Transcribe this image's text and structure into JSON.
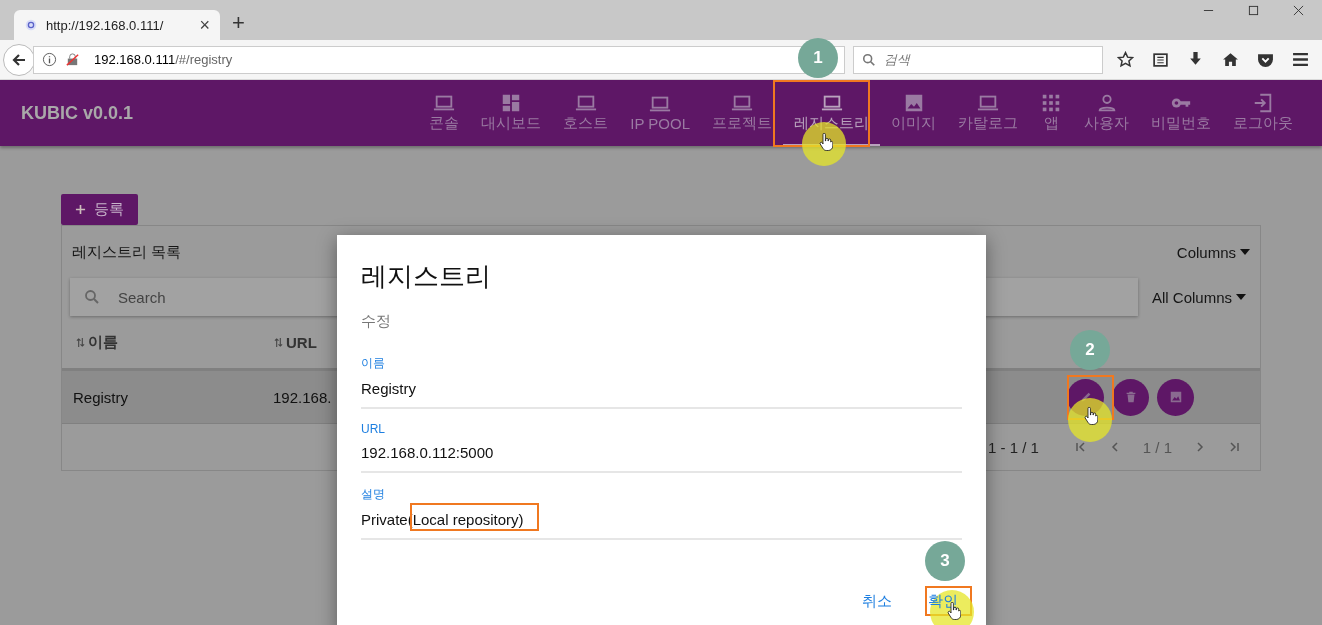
{
  "browser": {
    "tab_title": "http://192.168.0.111/",
    "tab_close": "×",
    "new_tab": "+",
    "address_host": "192.168.0.111",
    "address_path": "/#/registry",
    "search_placeholder": "검색"
  },
  "app": {
    "title": "KUBIC v0.0.1",
    "nav": [
      {
        "label": "콘솔",
        "kind": "laptop",
        "selected": false
      },
      {
        "label": "대시보드",
        "kind": "dashboard",
        "selected": false
      },
      {
        "label": "호스트",
        "kind": "laptop",
        "selected": false
      },
      {
        "label": "IP POOL",
        "kind": "laptop",
        "selected": false
      },
      {
        "label": "프로젝트",
        "kind": "laptop",
        "selected": false
      },
      {
        "label": "레지스트리",
        "kind": "laptop",
        "selected": true
      },
      {
        "label": "이미지",
        "kind": "image",
        "selected": false
      },
      {
        "label": "카탈로그",
        "kind": "laptop",
        "selected": false
      },
      {
        "label": "앱",
        "kind": "apps",
        "selected": false
      },
      {
        "label": "사용자",
        "kind": "person",
        "selected": false
      },
      {
        "label": "비밀번호",
        "kind": "key",
        "selected": false
      },
      {
        "label": "로그아웃",
        "kind": "logout",
        "selected": false
      }
    ]
  },
  "register_button": "등록",
  "table": {
    "title": "레지스트리 목록",
    "columns_menu": "Columns",
    "search_placeholder": "Search",
    "search_scope": "All Columns",
    "columns": [
      "이름",
      "URL"
    ],
    "rows": [
      {
        "cells": [
          "Registry",
          "192.168."
        ],
        "selected": true
      }
    ],
    "range": "1 - 1 / 1",
    "page": "1 / 1"
  },
  "dialog": {
    "title": "레지스트리",
    "subtitle": "수정",
    "fields": [
      {
        "label": "이름",
        "value": "Registry"
      },
      {
        "label": "URL",
        "value": "192.168.0.112:5000"
      },
      {
        "label": "설명",
        "value": "Private(Local repository)"
      }
    ],
    "buttons": [
      "취소",
      "확인"
    ]
  },
  "annotations": {
    "steps": [
      {
        "number": "1"
      },
      {
        "number": "2"
      },
      {
        "number": "3"
      }
    ]
  }
}
